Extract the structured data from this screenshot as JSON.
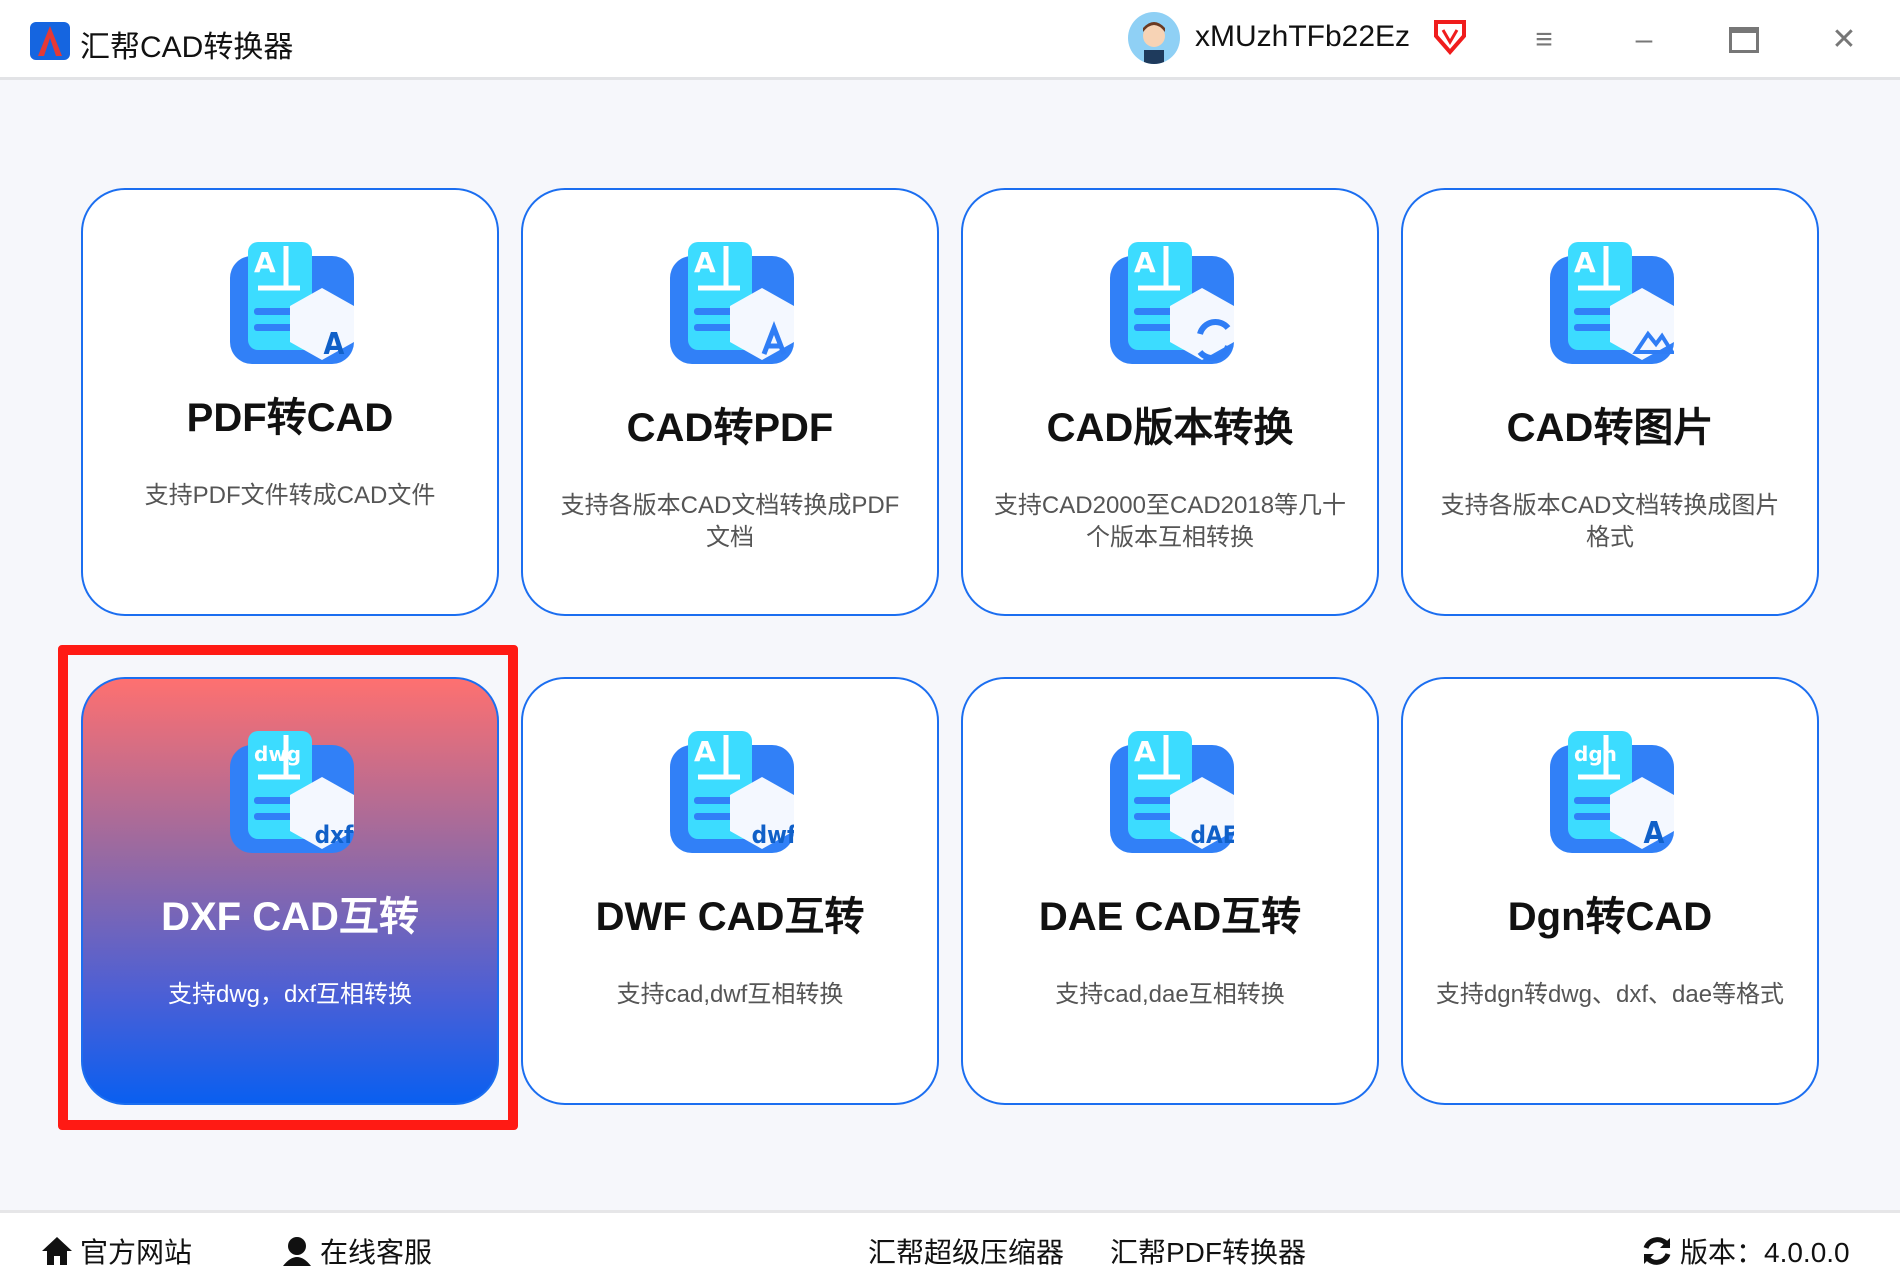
{
  "header": {
    "title": "汇帮CAD转换器",
    "username": "xMUzhTFb22Ez",
    "icons": [
      "logo-icon",
      "avatar",
      "vip-heart-icon",
      "menu-icon",
      "minimize-icon",
      "maximize-icon",
      "close-icon"
    ]
  },
  "cards": [
    {
      "title": "PDF转CAD",
      "desc": "支持PDF文件转成CAD文件",
      "badge": "A"
    },
    {
      "title": "CAD转PDF",
      "desc": "支持各版本CAD文档转换成PDF文档",
      "badge": "pdf"
    },
    {
      "title": "CAD版本转换",
      "desc": "支持CAD2000至CAD2018等几十个版本互相转换",
      "badge": "arrows"
    },
    {
      "title": "CAD转图片",
      "desc": "支持各版本CAD文档转换成图片格式",
      "badge": "image"
    },
    {
      "title": "DXF CAD互转",
      "desc": "支持dwg，dxf互相转换",
      "badge": "dxf",
      "selected": true
    },
    {
      "title": "DWF CAD互转",
      "desc": "支持cad,dwf互相转换",
      "badge": "dwf"
    },
    {
      "title": "DAE CAD互转",
      "desc": "支持cad,dae互相转换",
      "badge": "dAE"
    },
    {
      "title": "Dgn转CAD",
      "desc": "支持dgn转dwg、dxf、dae等格式",
      "badge": "A"
    }
  ],
  "footer": {
    "website": "官方网站",
    "support": "在线客服",
    "compressor": "汇帮超级压缩器",
    "pdf_converter": "汇帮PDF转换器",
    "version": "版本：4.0.0.0"
  },
  "colors": {
    "accent": "#1b6ef0",
    "highlight": "#ff1a14",
    "selected_gradient_top": "#fe7070",
    "selected_gradient_bottom": "#0a5ff0"
  }
}
